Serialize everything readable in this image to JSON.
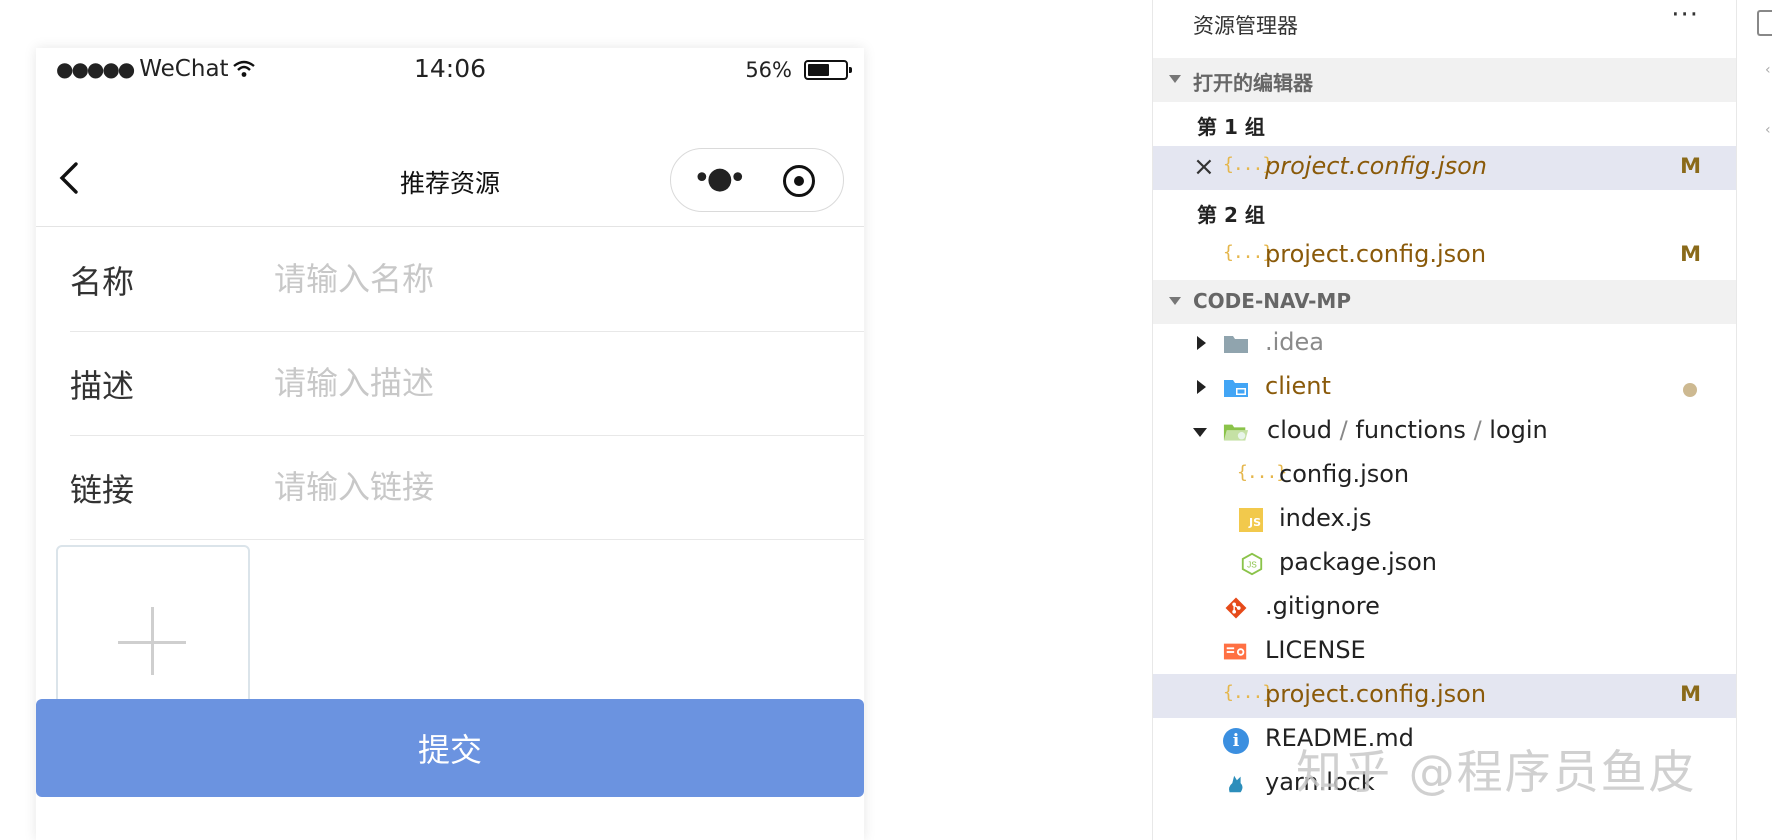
{
  "phone": {
    "status_bar": {
      "signal_dots": "●●●●●",
      "carrier": "WeChat",
      "time": "14:06",
      "battery_percent": "56%"
    },
    "nav": {
      "title": "推荐资源"
    },
    "form": {
      "fields": [
        {
          "label": "名称",
          "placeholder": "请输入名称"
        },
        {
          "label": "描述",
          "placeholder": "请输入描述"
        },
        {
          "label": "链接",
          "placeholder": "请输入链接"
        }
      ],
      "upload_plus": "+",
      "submit_label": "提交"
    }
  },
  "explorer": {
    "title": "资源管理器",
    "more": "···",
    "open_editors": {
      "label": "打开的编辑器",
      "groups": [
        {
          "label": "第 1 组",
          "file": "project.config.json",
          "badge": "M"
        },
        {
          "label": "第 2 组",
          "file": "project.config.json",
          "badge": "M"
        }
      ]
    },
    "project": {
      "label": "CODE-NAV-MP",
      "items": [
        {
          "name": ".idea"
        },
        {
          "name": "client"
        },
        {
          "path": [
            "cloud",
            "functions",
            "login"
          ],
          "separator": "/"
        },
        {
          "name": "config.json"
        },
        {
          "name": "index.js",
          "icon_text": "JS"
        },
        {
          "name": "package.json"
        },
        {
          "name": ".gitignore"
        },
        {
          "name": "LICENSE"
        },
        {
          "name": "project.config.json",
          "badge": "M"
        },
        {
          "name": "README.md",
          "icon_text": "i"
        },
        {
          "name": "yarn.lock"
        }
      ]
    },
    "colors": {
      "selection": "#e4e6f1",
      "modified_text": "#8a5a0a",
      "json_icon": "#e5b64b",
      "submit_button": "#6b93e0"
    }
  },
  "watermark": "知乎 @程序员鱼皮"
}
